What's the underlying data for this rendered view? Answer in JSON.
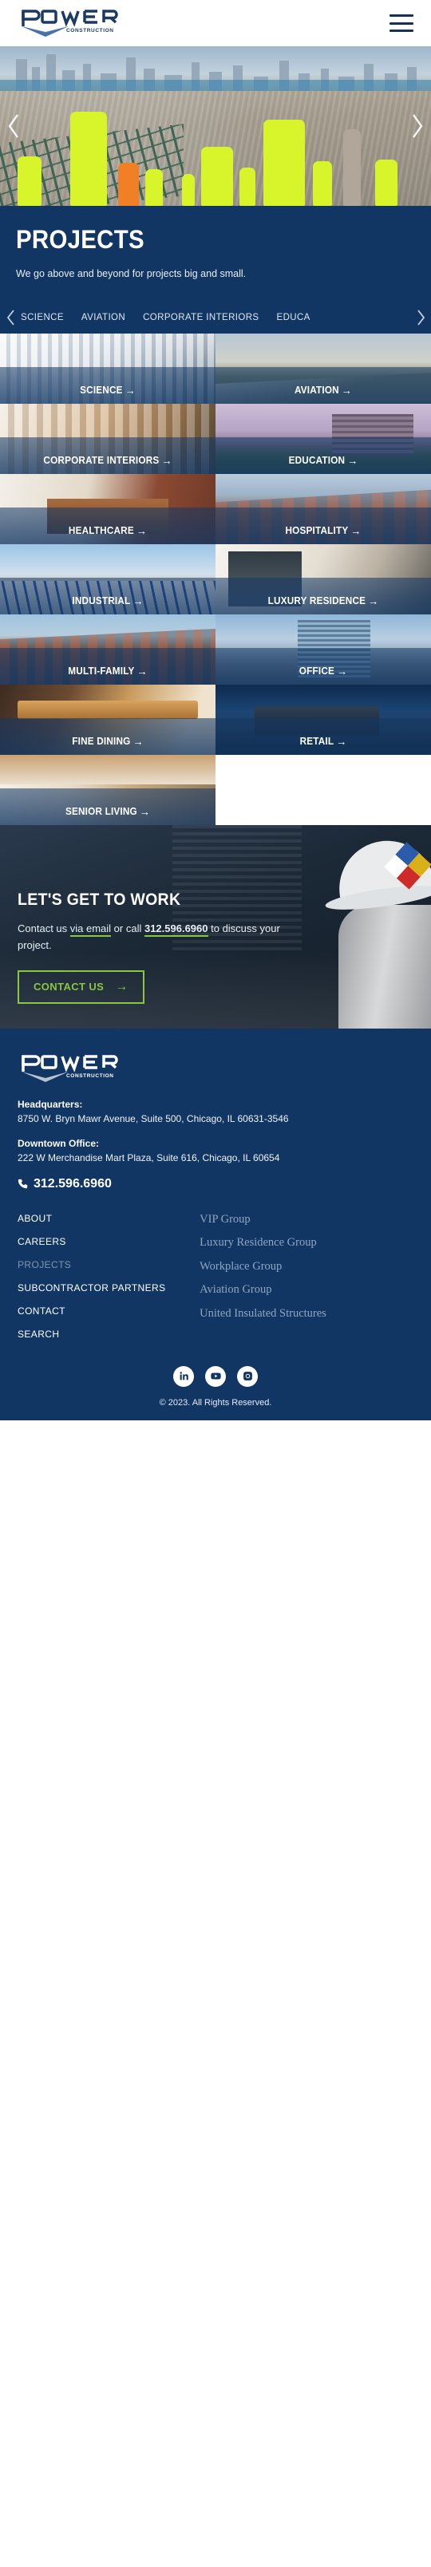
{
  "header": {
    "brand_name": "POWER",
    "brand_sub": "CONSTRUCTION",
    "menu_label": "Menu"
  },
  "hero": {
    "prev_label": "Previous slide",
    "next_label": "Next slide"
  },
  "titleband": {
    "title": "PROJECTS",
    "subtitle": "We go above and beyond for projects big and small."
  },
  "filters": {
    "prev_label": "Scroll categories left",
    "next_label": "Scroll categories right",
    "items": [
      {
        "label": "SCIENCE"
      },
      {
        "label": "AVIATION"
      },
      {
        "label": "CORPORATE INTERIORS"
      },
      {
        "label": "EDUCA"
      }
    ]
  },
  "grid": {
    "arrow": "→",
    "cards": [
      {
        "label": "SCIENCE",
        "photo": "p-science"
      },
      {
        "label": "AVIATION",
        "photo": "p-aviation"
      },
      {
        "label": "CORPORATE INTERIORS",
        "photo": "p-corporate"
      },
      {
        "label": "EDUCATION",
        "photo": "p-education"
      },
      {
        "label": "HEALTHCARE",
        "photo": "p-healthcare"
      },
      {
        "label": "HOSPITALITY",
        "photo": "p-hospitality"
      },
      {
        "label": "INDUSTRIAL",
        "photo": "p-industrial"
      },
      {
        "label": "LUXURY RESIDENCE",
        "photo": "p-luxury"
      },
      {
        "label": "MULTI-FAMILY",
        "photo": "p-multifamily"
      },
      {
        "label": "OFFICE",
        "photo": "p-office"
      },
      {
        "label": "FINE DINING",
        "photo": "p-finedining"
      },
      {
        "label": "RETAIL",
        "photo": "p-retail"
      },
      {
        "label": "SENIOR LIVING",
        "photo": "p-senior"
      }
    ]
  },
  "cta": {
    "title": "LET'S GET TO WORK",
    "copy_before": "Contact us ",
    "email_link": "via email",
    "copy_mid": " or call ",
    "phone_link": "312.596.6960",
    "copy_after": " to discuss your project.",
    "button_label": "CONTACT US",
    "button_arrow": "→"
  },
  "footer": {
    "brand_name": "POWER",
    "brand_sub": "CONSTRUCTION",
    "hq_label": "Headquarters:",
    "hq_address": "8750 W. Bryn Mawr Avenue, Suite 500, Chicago, IL 60631-3546",
    "downtown_label": "Downtown Office:",
    "downtown_address": "222 W Merchandise Mart Plaza, Suite 616, Chicago, IL 60654",
    "phone": "312.596.6960",
    "nav": [
      {
        "label": "ABOUT",
        "current": false
      },
      {
        "label": "CAREERS",
        "current": false
      },
      {
        "label": "PROJECTS",
        "current": true
      },
      {
        "label": "SUBCONTRACTOR PARTNERS",
        "current": false
      },
      {
        "label": "CONTACT",
        "current": false
      },
      {
        "label": "SEARCH",
        "current": false
      }
    ],
    "groups": [
      {
        "label": "VIP Group"
      },
      {
        "label": "Luxury Residence Group"
      },
      {
        "label": "Workplace Group"
      },
      {
        "label": "Aviation Group"
      },
      {
        "label": "United Insulated Structures"
      }
    ],
    "social": [
      {
        "name": "linkedin"
      },
      {
        "name": "youtube"
      },
      {
        "name": "instagram"
      }
    ],
    "copyright": "© 2023. All Rights Reserved."
  },
  "colors": {
    "brand_blue": "#123663",
    "accent_green": "#8cc63e",
    "muted_blue": "#8ea6c2"
  }
}
